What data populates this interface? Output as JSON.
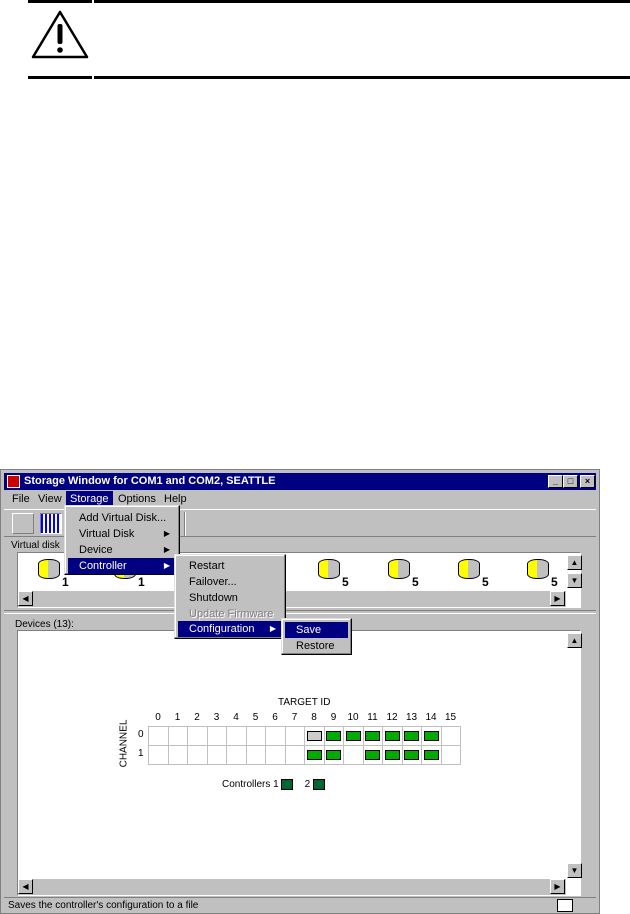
{
  "window": {
    "title": "Storage Window for COM1 and COM2, SEATTLE",
    "min": "_",
    "max": "□",
    "close": "×"
  },
  "menubar": [
    "File",
    "View",
    "Storage",
    "Options",
    "Help"
  ],
  "storage_menu": [
    {
      "label": "Add Virtual Disk..."
    },
    {
      "label": "Virtual Disk",
      "sub": true
    },
    {
      "label": "Device",
      "sub": true
    },
    {
      "label": "Controller",
      "sub": true
    }
  ],
  "controller_menu": [
    {
      "label": "Restart"
    },
    {
      "label": "Failover..."
    },
    {
      "label": "Shutdown"
    },
    {
      "label": "Update Firmware",
      "disabled": true
    },
    {
      "label": "Configuration",
      "sub": true
    }
  ],
  "configuration_menu": [
    "Save",
    "Restore"
  ],
  "virtual_disks": {
    "label": "Virtual disk",
    "raid_levels": [
      "1",
      "1",
      "5",
      "5",
      "5",
      "5"
    ]
  },
  "devices": {
    "label": "Devices (13):",
    "target_label": "TARGET ID",
    "channel_label": "CHANNEL",
    "target_ids": [
      "0",
      "1",
      "2",
      "3",
      "4",
      "5",
      "6",
      "7",
      "8",
      "9",
      "10",
      "11",
      "12",
      "13",
      "14",
      "15"
    ],
    "channels": [
      "0",
      "1"
    ],
    "controllers_label": "Controllers",
    "controllers": [
      "1",
      "2"
    ]
  },
  "status": "Saves the controller's configuration to a file"
}
